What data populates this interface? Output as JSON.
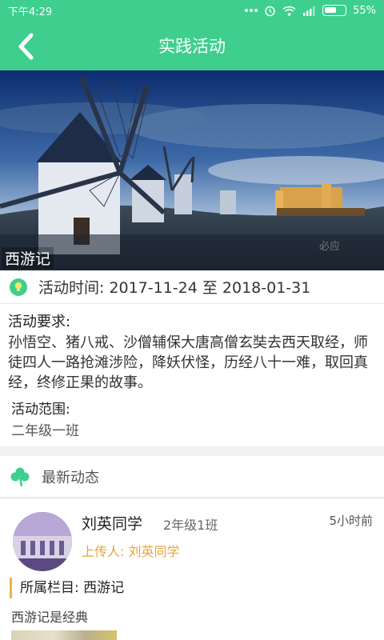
{
  "status_bar": {
    "time": "下午4:29",
    "battery": "55%",
    "icons": [
      "dots-icon",
      "alarm-icon",
      "wifi-icon",
      "signal-icon",
      "battery-icon"
    ]
  },
  "app_bar": {
    "title": "实践活动",
    "back_icon": "back-chevron-icon"
  },
  "hero": {
    "caption": "西游记",
    "watermark": "必应"
  },
  "activity": {
    "time_label": "活动时间:",
    "time_value": "2017-11-24 至 2018-01-31",
    "requirement_label": "活动要求:",
    "requirement_text": "孙悟空、猪八戒、沙僧辅保大唐高僧玄奘去西天取经，师徒四人一路抢滩涉险，降妖伏怪，历经八十一难，取回真经，终修正果的故事。",
    "scope_label": "活动范围:",
    "scope_value": "二年级一班"
  },
  "news": {
    "header": "最新动态",
    "post": {
      "name": "刘英同学",
      "class": "2年级1班",
      "time_ago": "5小时前",
      "uploader": "上传人: 刘英同学",
      "column": "所属栏目: 西游记",
      "description": "西游记是经典"
    }
  },
  "colors": {
    "accent": "#3ecf8e",
    "uploader": "#e5a53a",
    "column_bar": "#f0b33f"
  }
}
